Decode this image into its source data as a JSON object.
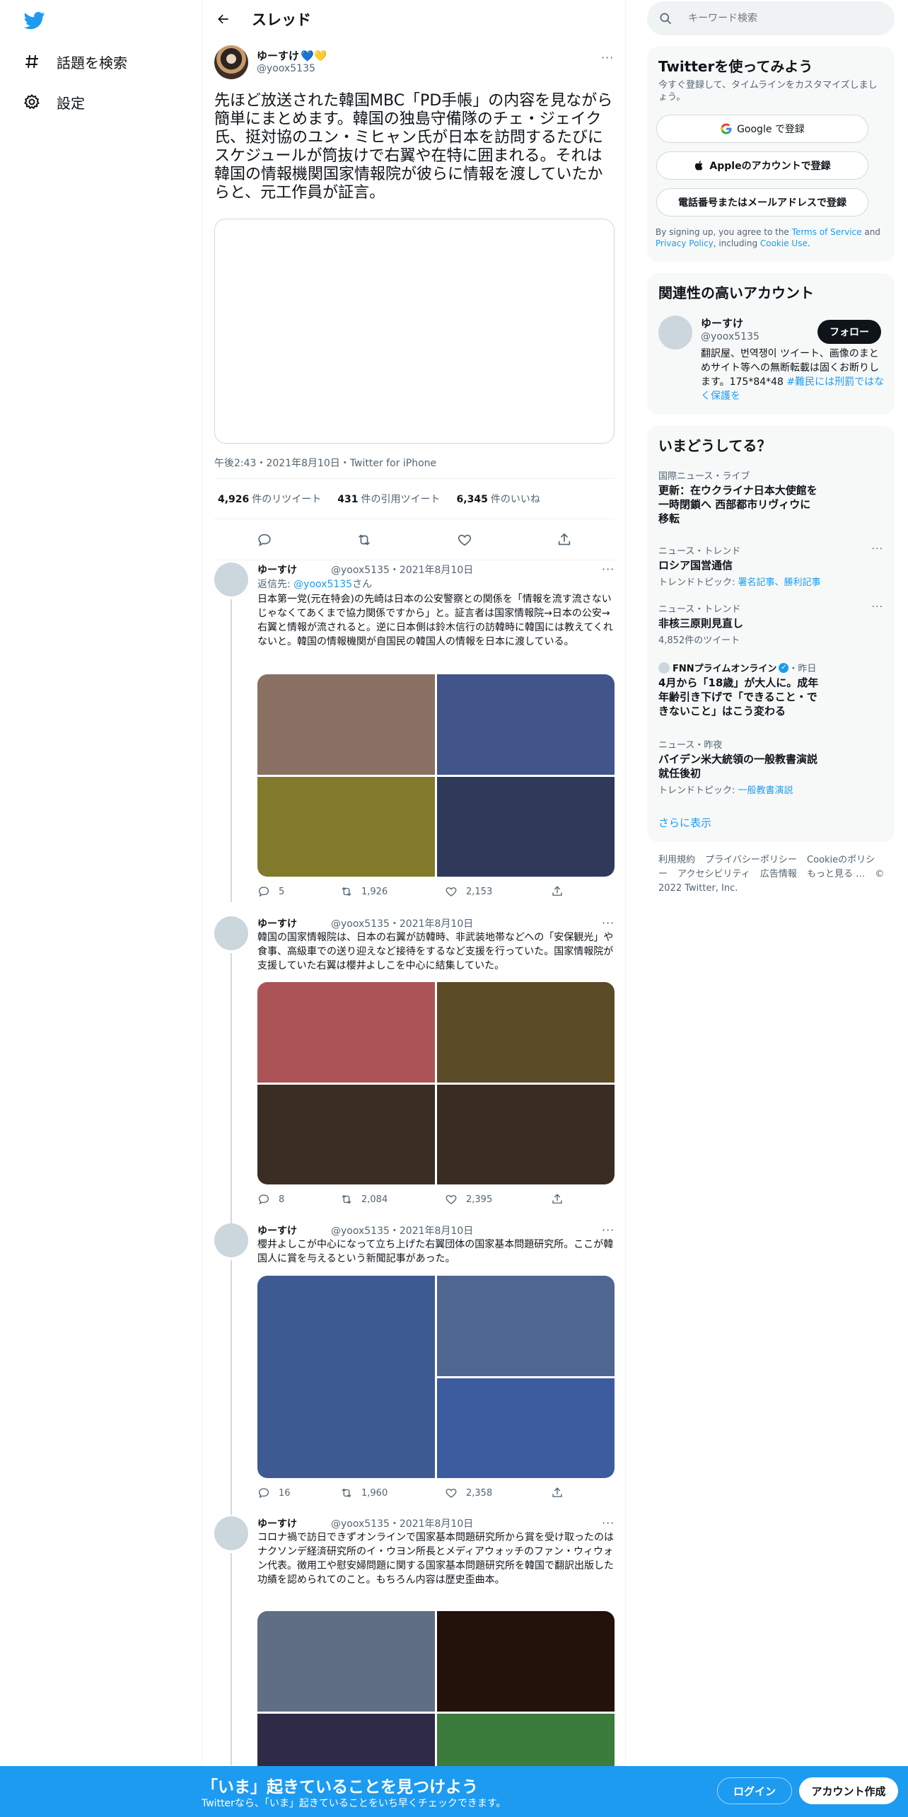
{
  "nav": {
    "logo": "twitter-bird-icon",
    "items": [
      {
        "label": "話題を検索",
        "icon": "hashtag-icon"
      },
      {
        "label": "設定",
        "icon": "gear-icon"
      }
    ]
  },
  "header": {
    "title": "スレッド"
  },
  "main_tweet": {
    "name": "ゆーすけ",
    "name_emoji": "💙💛",
    "handle": "@yoox5135",
    "text": "先ほど放送された韓国MBC「PD手帳」の内容を見ながら簡単にまとめます。韓国の独島守備隊のチェ・ジェイク氏、挺対協のユン・ミヒャン氏が日本を訪問するたびにスケジュールが筒抜けで右翼や在特に囲まれる。それは韓国の情報機関国家情報院が彼らに情報を渡していたからと、元工作員が証言。",
    "meta": "午後2:43・2021年8月10日・Twitter for iPhone",
    "retweets": "4,926",
    "retweets_label": "件のリツイート",
    "quotes": "431",
    "quotes_label": "件の引用ツイート",
    "likes": "6,345",
    "likes_label": "件のいいね"
  },
  "replies": [
    {
      "name": "ゆーすけ",
      "handle": "@yoox5135・2021年8月10日",
      "reply_to_prefix": "返信先: ",
      "reply_to_handle": "@yoox5135",
      "reply_to_suffix": "さん",
      "text": "日本第一党(元在特会)の先崎は日本の公安警察との関係を「情報を流す流さないじゃなくてあくまで協力関係ですから」と。証言者は国家情報院→日本の公安→右翼と情報が流されると。逆に日本側は鈴木信行の訪韓時に韓国には教えてくれないと。韓国の情報機関が自国民の韓国人の情報を日本に渡している。",
      "replies": "5",
      "retweets": "1,926",
      "likes": "2,153",
      "colors": [
        "#8a7063",
        "#41558a",
        "#817a2a",
        "#2f3a5b"
      ]
    },
    {
      "name": "ゆーすけ",
      "handle": "@yoox5135・2021年8月10日",
      "text": "韓国の国家情報院は、日本の右翼が訪韓時、非武装地帯などへの「安保観光」や食事、高級車での送り迎えなど接待をするなど支援を行っていた。国家情報院が支援していた右翼は櫻井よしこを中心に結集していた。",
      "replies": "8",
      "retweets": "2,084",
      "likes": "2,395",
      "colors": [
        "#ab5357",
        "#5b4b26",
        "#392d24",
        "#392c22"
      ]
    },
    {
      "name": "ゆーすけ",
      "handle": "@yoox5135・2021年8月10日",
      "text": "櫻井よしこが中心になって立ち上げた右翼団体の国家基本問題研究所。ここが韓国人に賞を与えるという新聞記事があった。",
      "replies": "16",
      "retweets": "1,960",
      "likes": "2,358",
      "colors": [
        "#3e5a92",
        "#4f6690",
        "#3d5c9f"
      ]
    },
    {
      "name": "ゆーすけ",
      "handle": "@yoox5135・2021年8月10日",
      "text": "コロナ禍で訪日できずオンラインで国家基本問題研究所から賞を受け取ったのはナクソンデ経済研究所のイ・ウヨン所長とメディアウォッチのファン・ウィウォン代表。徴用工や慰安婦問題に関する国家基本問題研究所を韓国で翻訳出版した功績を認められてのこと。もちろん内容は歴史歪曲本。",
      "colors": [
        "#5f6e82",
        "#22120b",
        "#2f2a45",
        "#3b7b3c"
      ]
    }
  ],
  "search": {
    "placeholder": "キーワード検索"
  },
  "signup": {
    "title": "Twitterを使ってみよう",
    "subtitle": "今すぐ登録して、タイムラインをカスタマイズしましょう。",
    "google": "Google で登録",
    "apple": "Appleのアカウントで登録",
    "phone": "電話番号またはメールアドレスで登録",
    "legal_1": "By signing up, you agree to the ",
    "legal_tos": "Terms of Service",
    "legal_2": " and ",
    "legal_privacy": "Privacy Policy",
    "legal_3": ", including ",
    "legal_cookie": "Cookie Use",
    "legal_4": "."
  },
  "related": {
    "title": "関連性の高いアカウント",
    "name": "ゆーすけ",
    "handle": "@yoox5135",
    "follow": "フォロー",
    "bio": "翻訳屋、번역쟁이 ツイート、画像のまとめサイト等への無断転載は固くお断りします。175*84*48 ",
    "bio_tag": "#難民には刑罰ではなく保護を"
  },
  "trends": {
    "title": "いまどうしてる？",
    "items": [
      {
        "category": "国際ニュース・ライブ",
        "title": "更新：在ウクライナ日本大使館を一時閉鎖へ 西部都市リヴィウに移転"
      },
      {
        "category": "ニュース・トレンド",
        "title": "ロシア国営通信",
        "meta_prefix": "トレンドトピック: ",
        "meta_links": "署名記事、勝利記事"
      },
      {
        "category": "ニュース・トレンド",
        "title": "非核三原則見直し",
        "meta": "4,852件のツイート"
      },
      {
        "source": "FNNプライムオンライン",
        "time": "・昨日",
        "title": "4月から「18歳」が大人に。成年年齢引き下げで「できること・できないこと」はこう変わる"
      },
      {
        "category": "ニュース・昨夜",
        "title": "バイデン米大統領の一般教書演説 就任後初",
        "meta_prefix": "トレンドトピック: ",
        "meta_links": "一般教書演説"
      }
    ],
    "show_more": "さらに表示"
  },
  "footer": {
    "links": [
      "利用規約",
      "プライバシーポリシー",
      "Cookieのポリシー",
      "アクセシビリティ",
      "広告情報",
      "もっと見る …",
      "© 2022 Twitter, Inc."
    ]
  },
  "bottom_bar": {
    "title": "「いま」起きていることを見つけよう",
    "subtitle": "Twitterなら、「いま」起きていることをいち早くチェックできます。",
    "login": "ログイン",
    "signup": "アカウント作成"
  },
  "colors": {
    "accent": "#1d9bf0",
    "text": "#0f1419",
    "muted": "#536471"
  }
}
